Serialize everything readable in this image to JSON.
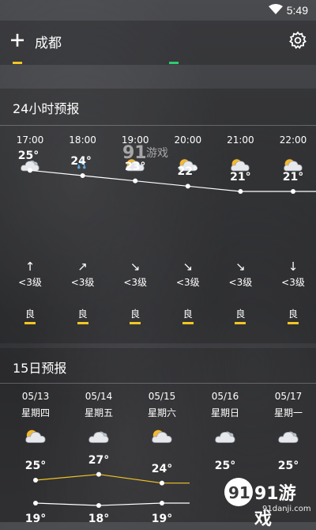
{
  "status_bar": {
    "time": "5:49"
  },
  "header": {
    "city": "成都"
  },
  "hourly": {
    "title": "24小时预报",
    "items": [
      {
        "time": "17:00",
        "icon": "cloudy-icon",
        "temp": "25°",
        "wind_dir": "↑",
        "wind_level": "<3级",
        "aqi": "良"
      },
      {
        "time": "18:00",
        "icon": "light-rain-icon",
        "temp": "24°",
        "wind_dir": "↗",
        "wind_level": "<3级",
        "aqi": "良"
      },
      {
        "time": "19:00",
        "icon": "partly-cloudy-icon",
        "temp": "23°",
        "wind_dir": "↘",
        "wind_level": "<3级",
        "aqi": "良"
      },
      {
        "time": "20:00",
        "icon": "partly-cloudy-icon",
        "temp": "22°",
        "wind_dir": "↘",
        "wind_level": "<3级",
        "aqi": "良"
      },
      {
        "time": "21:00",
        "icon": "partly-cloudy-icon",
        "temp": "21°",
        "wind_dir": "↘",
        "wind_level": "<3级",
        "aqi": "良"
      },
      {
        "time": "22:00",
        "icon": "partly-cloudy-icon",
        "temp": "21°",
        "wind_dir": "↓",
        "wind_level": "<3级",
        "aqi": "良"
      }
    ]
  },
  "daily": {
    "title": "15日预报",
    "items": [
      {
        "date": "05/13",
        "weekday": "星期四",
        "icon": "partly-cloudy-icon",
        "high": "25°",
        "low": "19°"
      },
      {
        "date": "05/14",
        "weekday": "星期五",
        "icon": "cloudy-icon",
        "high": "27°",
        "low": "18°"
      },
      {
        "date": "05/15",
        "weekday": "星期六",
        "icon": "partly-cloudy-icon",
        "high": "24°",
        "low": "19°"
      },
      {
        "date": "05/16",
        "weekday": "星期日",
        "icon": "cloudy-icon",
        "high": "25°",
        "low": ""
      },
      {
        "date": "05/17",
        "weekday": "星期一",
        "icon": "cloudy-icon",
        "high": "25°",
        "low": ""
      }
    ]
  },
  "watermark": {
    "brand": "91游戏",
    "url": "91danji.com"
  },
  "colors": {
    "aqi_good": "#f3c623",
    "high_line": "#f3c623",
    "low_line": "#ffffff"
  }
}
